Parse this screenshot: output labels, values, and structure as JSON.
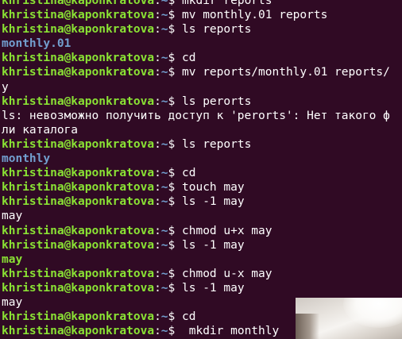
{
  "terminal": {
    "lines": [
      {
        "type": "prompt",
        "user": "khristina@kaponkratova",
        "path": "~",
        "cmd": "mkdir reports"
      },
      {
        "type": "prompt",
        "user": "khristina@kaponkratova",
        "path": "~",
        "cmd": "mv monthly.01 reports"
      },
      {
        "type": "prompt",
        "user": "khristina@kaponkratova",
        "path": "~",
        "cmd": "ls reports"
      },
      {
        "type": "dir",
        "text": "monthly.01"
      },
      {
        "type": "prompt",
        "user": "khristina@kaponkratova",
        "path": "~",
        "cmd": "cd"
      },
      {
        "type": "prompt",
        "user": "khristina@kaponkratova",
        "path": "~",
        "cmd": "mv reports/monthly.01 reports/"
      },
      {
        "type": "output",
        "text": "y"
      },
      {
        "type": "prompt",
        "user": "khristina@kaponkratova",
        "path": "~",
        "cmd": "ls perorts"
      },
      {
        "type": "output",
        "text": "ls: невозможно получить доступ к 'perorts': Нет такого ф"
      },
      {
        "type": "output",
        "text": "ли каталога"
      },
      {
        "type": "prompt",
        "user": "khristina@kaponkratova",
        "path": "~",
        "cmd": "ls reports"
      },
      {
        "type": "dir",
        "text": "monthly"
      },
      {
        "type": "prompt",
        "user": "khristina@kaponkratova",
        "path": "~",
        "cmd": "cd"
      },
      {
        "type": "prompt",
        "user": "khristina@kaponkratova",
        "path": "~",
        "cmd": "touch may"
      },
      {
        "type": "prompt",
        "user": "khristina@kaponkratova",
        "path": "~",
        "cmd": "ls -1 may"
      },
      {
        "type": "output",
        "text": "may"
      },
      {
        "type": "prompt",
        "user": "khristina@kaponkratova",
        "path": "~",
        "cmd": "chmod u+x may"
      },
      {
        "type": "prompt",
        "user": "khristina@kaponkratova",
        "path": "~",
        "cmd": "ls -1 may"
      },
      {
        "type": "exe",
        "text": "may"
      },
      {
        "type": "prompt",
        "user": "khristina@kaponkratova",
        "path": "~",
        "cmd": "chmod u-x may"
      },
      {
        "type": "prompt",
        "user": "khristina@kaponkratova",
        "path": "~",
        "cmd": "ls -1 may"
      },
      {
        "type": "output",
        "text": "may"
      },
      {
        "type": "prompt",
        "user": "khristina@kaponkratova",
        "path": "~",
        "cmd": "cd"
      },
      {
        "type": "prompt",
        "user": "khristina@kaponkratova",
        "path": "~",
        "cmd": " mkdir monthly"
      }
    ],
    "prompt_separator": ":",
    "prompt_symbol": "$ "
  },
  "colors": {
    "background": "#300a24",
    "user": "#8ae234",
    "path": "#729fcf",
    "text": "#ffffff"
  }
}
